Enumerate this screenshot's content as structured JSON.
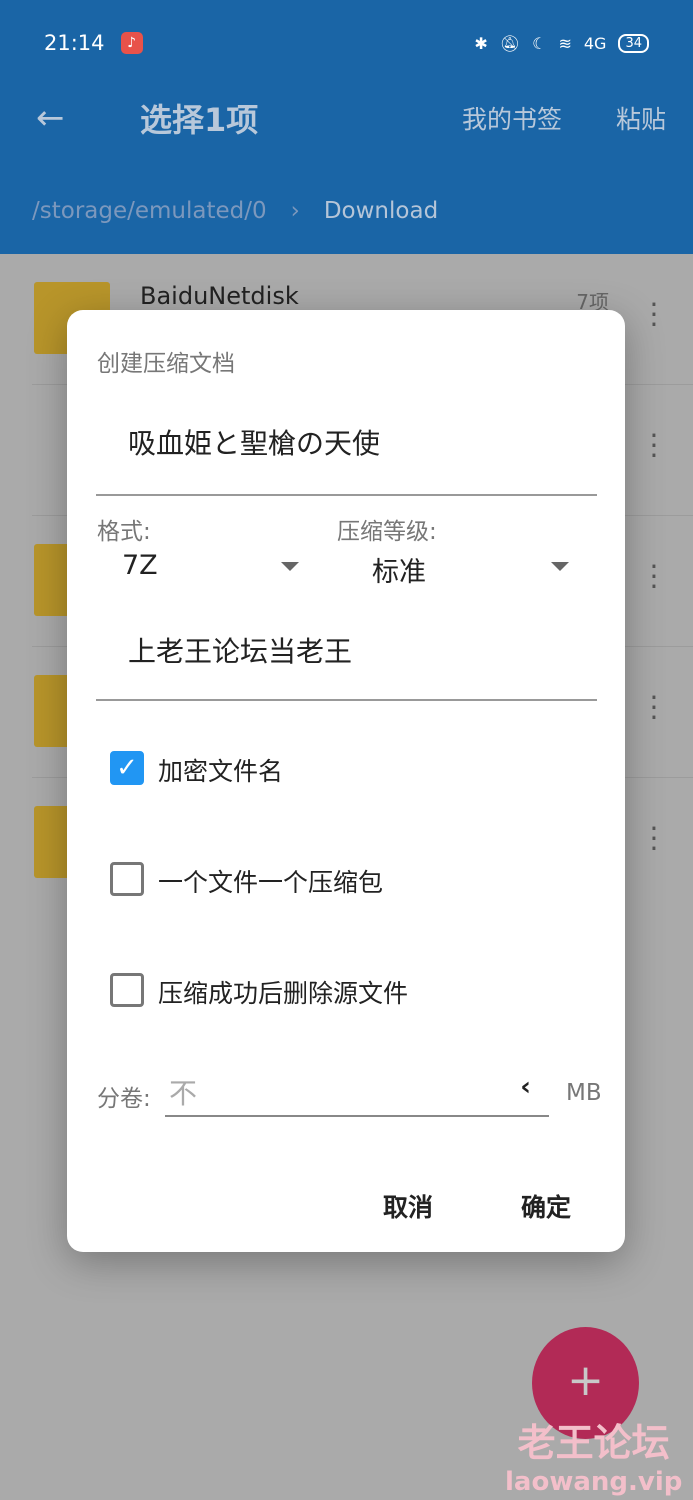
{
  "status": {
    "time": "21:14",
    "battery": "34",
    "network": "4G"
  },
  "toolbar": {
    "title": "选择1项",
    "bookmarks": "我的书签",
    "paste": "粘贴"
  },
  "breadcrumb": {
    "root": "/storage/emulated/0",
    "current": "Download"
  },
  "list": [
    {
      "name": "BaiduNetdisk",
      "count": "7项"
    }
  ],
  "dialog": {
    "title": "创建压缩文档",
    "filename": "吸血姫と聖槍の天使",
    "format_label": "格式:",
    "format_value": "7Z",
    "level_label": "压缩等级:",
    "level_value": "标准",
    "password": "上老王论坛当老王",
    "options": [
      {
        "label": "加密文件名",
        "checked": true
      },
      {
        "label": "一个文件一个压缩包",
        "checked": false
      },
      {
        "label": "压缩成功后删除源文件",
        "checked": false
      }
    ],
    "split_label": "分卷:",
    "split_placeholder": "不",
    "split_unit": "MB",
    "cancel": "取消",
    "ok": "确定"
  },
  "watermark": {
    "line1": "老王论坛",
    "line2": "laowang.vip"
  },
  "colors": {
    "header": "#1a65a6",
    "fab": "#b22a56",
    "checkbox": "#2196f3"
  }
}
